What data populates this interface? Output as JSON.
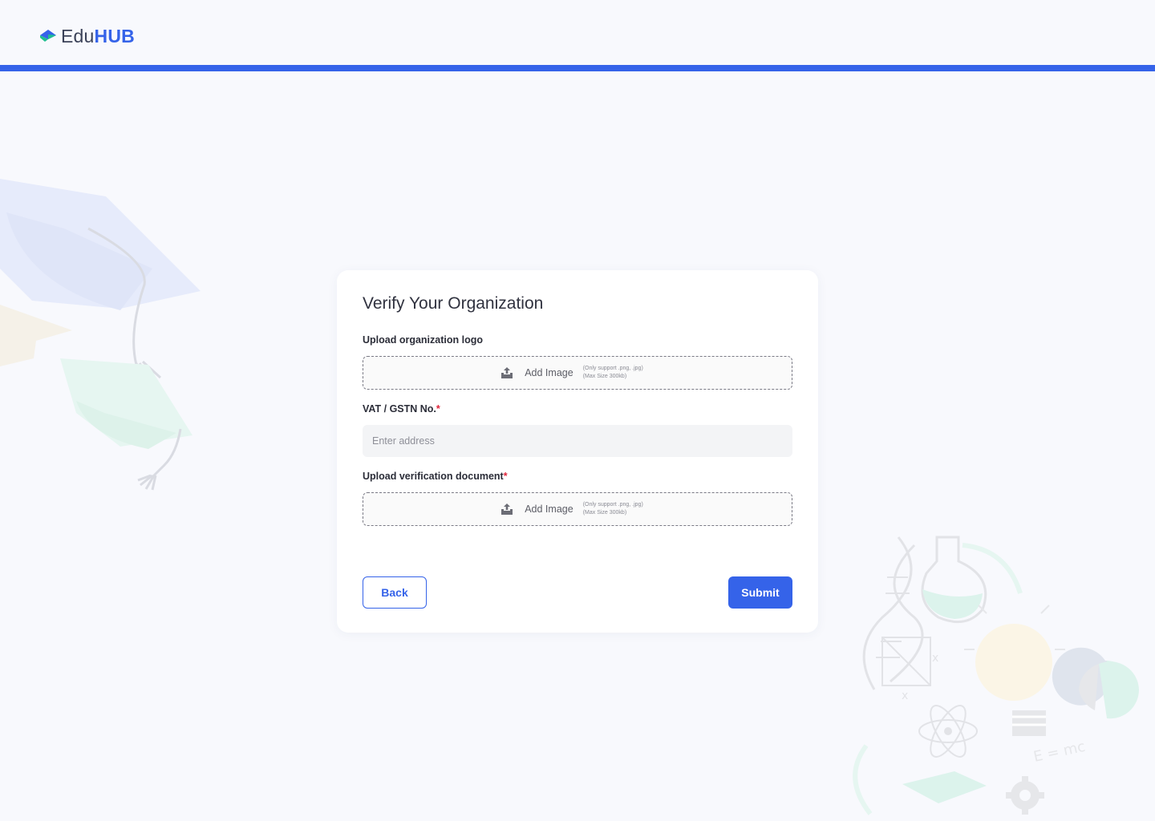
{
  "brand": {
    "name_part1": "Edu",
    "name_part2": "HUB",
    "accent": "#3563e9",
    "logo_icon": "graduation-cap-icon"
  },
  "form": {
    "title": "Verify Your Organization",
    "logo_upload": {
      "label": "Upload organization logo",
      "button_label": "Add Image",
      "hint_formats": "(Only support .png, .jpg)",
      "hint_size": "(Max Size 300kb)",
      "icon": "upload-icon"
    },
    "vat": {
      "label": "VAT / GSTN No.",
      "required_mark": "*",
      "placeholder": "Enter address",
      "value": ""
    },
    "doc_upload": {
      "label": "Upload verification document",
      "required_mark": "*",
      "button_label": "Add Image",
      "hint_formats": "(Only support .png, .jpg)",
      "hint_size": "(Max Size 300kb)",
      "icon": "upload-icon"
    },
    "back_label": "Back",
    "submit_label": "Submit"
  },
  "decor": {
    "formula_text": "E = mc",
    "axis_mark": "x"
  },
  "colors": {
    "primary": "#3563e9",
    "required": "#e0253a",
    "background": "#f8f9fd"
  }
}
